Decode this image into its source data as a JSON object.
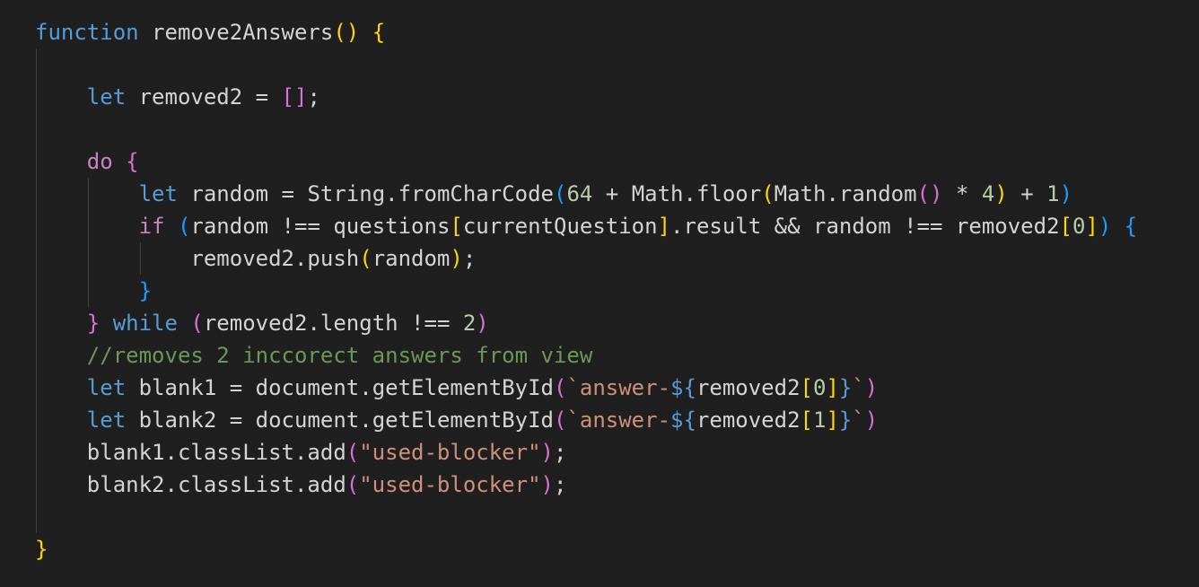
{
  "editor": {
    "theme": {
      "background": "#1f1f1f",
      "keyword": "#569cd6",
      "control": "#c586c0",
      "function": "#dcdcaa",
      "string": "#ce9178",
      "number": "#b5cea8",
      "comment": "#6a9955",
      "bracket_1": "#ffd700",
      "bracket_2": "#da70d6",
      "bracket_3": "#179fff"
    },
    "lines": [
      {
        "id": "line-1",
        "tokens": [
          [
            "kw",
            "function"
          ],
          [
            "plain",
            " remove2Answers"
          ],
          [
            "b1",
            "()"
          ],
          [
            "plain",
            " "
          ],
          [
            "b1",
            "{"
          ]
        ]
      },
      {
        "id": "line-2",
        "tokens": []
      },
      {
        "id": "line-3",
        "tokens": [
          [
            "plain",
            "    "
          ],
          [
            "kw",
            "let"
          ],
          [
            "plain",
            " removed2 = "
          ],
          [
            "b2",
            "[]"
          ],
          [
            "plain",
            ";"
          ]
        ]
      },
      {
        "id": "line-4",
        "tokens": []
      },
      {
        "id": "line-5",
        "tokens": [
          [
            "plain",
            "    "
          ],
          [
            "kw2",
            "do"
          ],
          [
            "plain",
            " "
          ],
          [
            "b2",
            "{"
          ]
        ]
      },
      {
        "id": "line-6",
        "tokens": [
          [
            "plain",
            "        "
          ],
          [
            "kw",
            "let"
          ],
          [
            "plain",
            " random = String.fromCharCode"
          ],
          [
            "b3",
            "("
          ],
          [
            "num",
            "64"
          ],
          [
            "plain",
            " + Math.floor"
          ],
          [
            "b1",
            "("
          ],
          [
            "plain",
            "Math.random"
          ],
          [
            "b2",
            "()"
          ],
          [
            "plain",
            " * "
          ],
          [
            "num",
            "4"
          ],
          [
            "b1",
            ")"
          ],
          [
            "plain",
            " + "
          ],
          [
            "num",
            "1"
          ],
          [
            "b3",
            ")"
          ]
        ]
      },
      {
        "id": "line-7",
        "tokens": [
          [
            "plain",
            "        "
          ],
          [
            "kw2",
            "if"
          ],
          [
            "plain",
            " "
          ],
          [
            "b3",
            "("
          ],
          [
            "plain",
            "random !== questions"
          ],
          [
            "b1",
            "["
          ],
          [
            "plain",
            "currentQuestion"
          ],
          [
            "b1",
            "]"
          ],
          [
            "plain",
            ".result && random !== removed2"
          ],
          [
            "b1",
            "["
          ],
          [
            "num",
            "0"
          ],
          [
            "b1",
            "]"
          ],
          [
            "b3",
            ")"
          ],
          [
            "plain",
            " "
          ],
          [
            "b3",
            "{"
          ]
        ]
      },
      {
        "id": "line-8",
        "tokens": [
          [
            "plain",
            "            removed2.push"
          ],
          [
            "b1",
            "("
          ],
          [
            "plain",
            "random"
          ],
          [
            "b1",
            ")"
          ],
          [
            "plain",
            ";"
          ]
        ]
      },
      {
        "id": "line-9",
        "tokens": [
          [
            "plain",
            "        "
          ],
          [
            "b3",
            "}"
          ]
        ]
      },
      {
        "id": "line-10",
        "tokens": [
          [
            "plain",
            "    "
          ],
          [
            "b2",
            "}"
          ],
          [
            "plain",
            " "
          ],
          [
            "kw",
            "while"
          ],
          [
            "plain",
            " "
          ],
          [
            "b2",
            "("
          ],
          [
            "plain",
            "removed2.length !== "
          ],
          [
            "num",
            "2"
          ],
          [
            "b2",
            ")"
          ]
        ]
      },
      {
        "id": "line-11",
        "tokens": [
          [
            "plain",
            "    "
          ],
          [
            "cmt",
            "//removes 2 inccorect answers from view"
          ]
        ]
      },
      {
        "id": "line-12",
        "tokens": [
          [
            "plain",
            "    "
          ],
          [
            "kw",
            "let"
          ],
          [
            "plain",
            " blank1 = document.getElementById"
          ],
          [
            "b2",
            "("
          ],
          [
            "str",
            "`answer-"
          ],
          [
            "kw",
            "${"
          ],
          [
            "plain",
            "removed2"
          ],
          [
            "b1",
            "["
          ],
          [
            "num",
            "0"
          ],
          [
            "b1",
            "]"
          ],
          [
            "kw",
            "}"
          ],
          [
            "str",
            "`"
          ],
          [
            "b2",
            ")"
          ]
        ]
      },
      {
        "id": "line-13",
        "tokens": [
          [
            "plain",
            "    "
          ],
          [
            "kw",
            "let"
          ],
          [
            "plain",
            " blank2 = document.getElementById"
          ],
          [
            "b2",
            "("
          ],
          [
            "str",
            "`answer-"
          ],
          [
            "kw",
            "${"
          ],
          [
            "plain",
            "removed2"
          ],
          [
            "b1",
            "["
          ],
          [
            "num",
            "1"
          ],
          [
            "b1",
            "]"
          ],
          [
            "kw",
            "}"
          ],
          [
            "str",
            "`"
          ],
          [
            "b2",
            ")"
          ]
        ]
      },
      {
        "id": "line-14",
        "tokens": [
          [
            "plain",
            "    blank1.classList.add"
          ],
          [
            "b2",
            "("
          ],
          [
            "str",
            "\"used-blocker\""
          ],
          [
            "b2",
            ")"
          ],
          [
            "plain",
            ";"
          ]
        ]
      },
      {
        "id": "line-15",
        "tokens": [
          [
            "plain",
            "    blank2.classList.add"
          ],
          [
            "b2",
            "("
          ],
          [
            "str",
            "\"used-blocker\""
          ],
          [
            "b2",
            ")"
          ],
          [
            "plain",
            ";"
          ]
        ]
      },
      {
        "id": "line-16",
        "tokens": []
      },
      {
        "id": "line-17",
        "tokens": [
          [
            "b1",
            "}"
          ]
        ]
      }
    ]
  }
}
